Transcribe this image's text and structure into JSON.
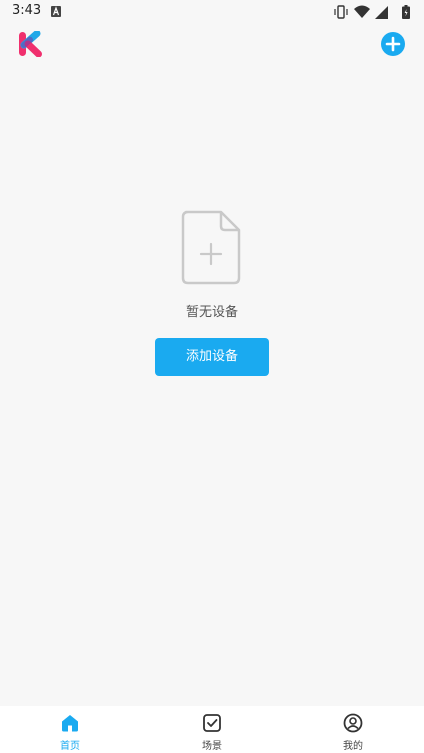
{
  "status_bar": {
    "time": "3:43"
  },
  "empty_state": {
    "message": "暂无设备",
    "add_button_label": "添加设备"
  },
  "bottom_nav": {
    "items": [
      {
        "label": "首页",
        "icon": "home-icon",
        "active": true
      },
      {
        "label": "场景",
        "icon": "checkbox-icon",
        "active": false
      },
      {
        "label": "我的",
        "icon": "profile-icon",
        "active": false
      }
    ]
  },
  "colors": {
    "accent": "#1aaaf0",
    "background": "#f7f7f7",
    "logo_pink": "#f0306e",
    "logo_blue": "#21a8e8"
  }
}
